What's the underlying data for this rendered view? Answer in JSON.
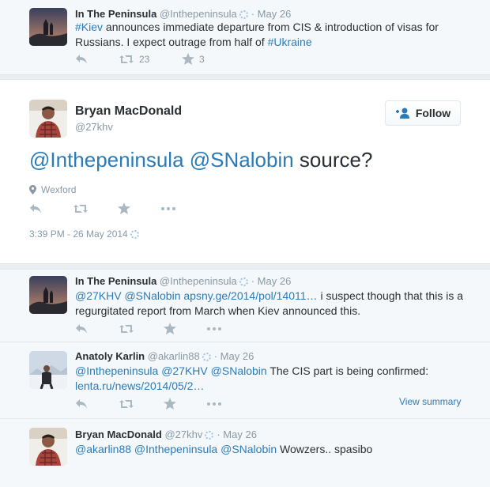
{
  "tweets": [
    {
      "name": "In The Peninsula",
      "handle": "@Inthepeninsula",
      "sep": "·",
      "date": "May 26",
      "text_parts": [
        "#Kiev",
        " announces immediate departure from CIS & introduction of visas for Russians. I expect outrage from half of ",
        "#Ukraine"
      ],
      "retweets": "23",
      "favorites": "3"
    },
    {
      "name": "In The Peninsula",
      "handle": "@Inthepeninsula",
      "sep": "·",
      "date": "May 26",
      "text_parts": [
        "@27KHV",
        " ",
        "@SNalobin",
        " ",
        "apsny.ge/2014/pol/14011…",
        " i suspect though that this is a regurgitated report from March when Kiev announced this."
      ]
    },
    {
      "name": "Anatoly Karlin",
      "handle": "@akarlin88",
      "sep": "·",
      "date": "May 26",
      "text_parts": [
        "@Inthepeninsula",
        " ",
        "@27KHV",
        " ",
        "@SNalobin",
        " The CIS part is being confirmed: ",
        "lenta.ru/news/2014/05/2…"
      ],
      "view_summary": "View summary"
    },
    {
      "name": "Bryan MacDonald",
      "handle": "@27khv",
      "sep": "·",
      "date": "May 26",
      "text_parts": [
        "@akarlin88",
        " ",
        "@Inthepeninsula",
        " ",
        "@SNalobin",
        " Wowzers.. spasibo"
      ]
    }
  ],
  "main_tweet": {
    "name": "Bryan MacDonald",
    "handle": "@27khv",
    "follow_label": "Follow",
    "text_parts": [
      "@Inthepeninsula",
      " ",
      "@SNalobin",
      " source?"
    ],
    "location": "Wexford",
    "timestamp": "3:39 PM - 26 May 2014"
  },
  "colors": {
    "link": "#2b7bb9",
    "icon": "#aab8c2",
    "background": "#f5f8fa"
  },
  "icons": [
    "reply-icon",
    "retweet-icon",
    "favorite-icon",
    "more-icon",
    "location-pin-icon",
    "follow-user-icon",
    "verified-loading-icon"
  ]
}
